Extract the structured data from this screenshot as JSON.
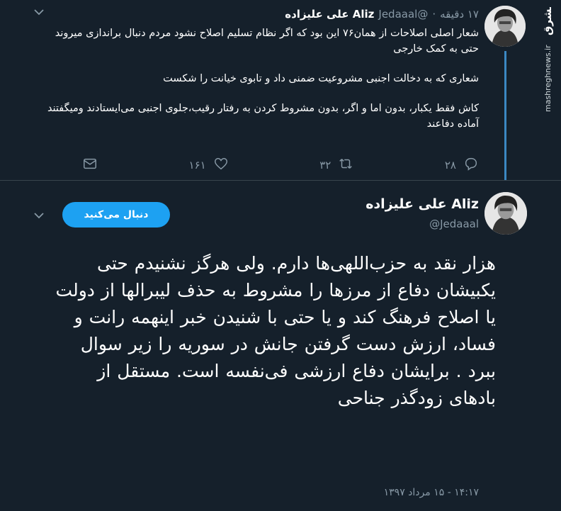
{
  "reply_tweet": {
    "name": "Aliz علی علیزاده",
    "handle": "@Jedaaal",
    "dot": "·",
    "time": "۱۷ دقیقه",
    "paragraphs": [
      "شعار اصلی اصلاحات از همان۷۶ این بود که اگر نظام تسلیم اصلاح نشود مردم دنبال براندازی میروند حتی به کمک خارجی",
      "شعاری که به دخالت اجنبی مشروعیت ضمنی داد و تابوی خیانت را شکست",
      "کاش فقط یکبار، بدون اما و اگر، بدون مشروط کردن به رفتار رقیب،جلوی اجنبی می‌ایستادند ومیگفتند آماده دفاعند"
    ],
    "actions": {
      "replies": "۲۸",
      "retweets": "۳۲",
      "likes": "۱۶۱"
    }
  },
  "main_tweet": {
    "name": "Aliz علی علیزاده",
    "handle": "@Jedaaal",
    "follow_label": "دنبال می‌کنید",
    "text": "هزار نقد به حزب‌اللهی‌ها دارم. ولی هرگز نشنیدم حتی یکبیشان دفاع از مرزها را مشروط به حذف لیبرالها از دولت یا اصلاح فرهنگ کند و یا حتی با شنیدن خبر اینهمه رانت و فساد، ارزش دست گرفتن جانش در سوریه را زیر سوال ببرد . برایشان دفاع ارزشی فی‌نفسه است. مستقل از بادهای زودگذر جناحی",
    "timestamp": "۱۴:۱۷ - ۱۵ مرداد ۱۳۹۷"
  },
  "watermark": {
    "text": "mashreghnews.ir",
    "brand": "مشرق"
  },
  "colors": {
    "background": "#15202b",
    "accent": "#1da1f2",
    "muted": "#8899a6",
    "thread": "#3b88c3"
  },
  "icons": [
    "reply-icon",
    "retweet-icon",
    "like-icon",
    "message-icon",
    "chevron-down-icon"
  ]
}
